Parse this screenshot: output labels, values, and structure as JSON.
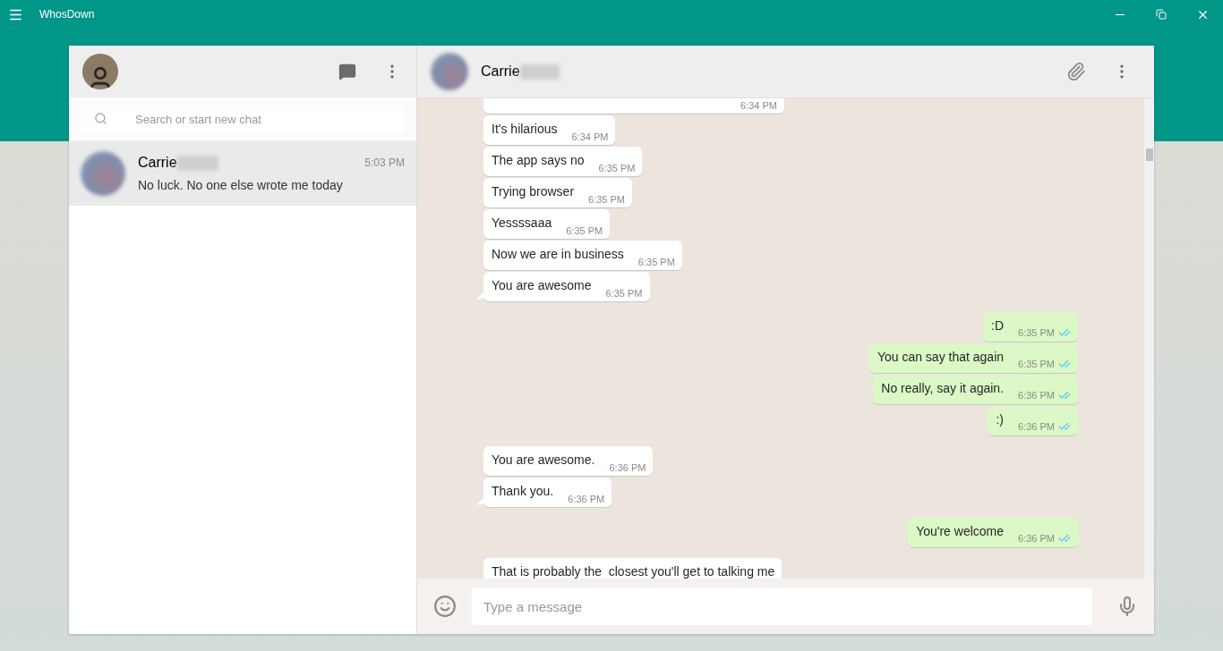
{
  "window": {
    "title": "WhosDown"
  },
  "search": {
    "placeholder": "Search or start new chat"
  },
  "chats": [
    {
      "name": "Carrie",
      "time": "5:03 PM",
      "preview": "No luck. No one else wrote me today",
      "selected": true
    }
  ],
  "conversation": {
    "name": "Carrie"
  },
  "message_groups": [
    {
      "kind": "incoming",
      "messages": [
        {
          "time": "6:34 PM"
        },
        {
          "text": "It's hilarious",
          "time": "6:34 PM"
        },
        {
          "text": "The app says no",
          "time": "6:35 PM"
        },
        {
          "text": "Trying browser",
          "time": "6:35 PM"
        },
        {
          "text": "Yessssaaa",
          "time": "6:35 PM"
        },
        {
          "text": "Now we are in business",
          "time": "6:35 PM"
        },
        {
          "text": "You are awesome",
          "time": "6:35 PM"
        }
      ]
    },
    {
      "kind": "outgoing",
      "messages": [
        {
          "text": ":D",
          "time": "6:35 PM",
          "read": true
        },
        {
          "text": "You can say that again",
          "time": "6:35 PM",
          "read": true
        },
        {
          "text": "No really, say it again.",
          "time": "6:36 PM",
          "read": true
        },
        {
          "text": ":)",
          "time": "6:36 PM",
          "read": true
        }
      ]
    },
    {
      "kind": "incoming",
      "messages": [
        {
          "text": "You are awesome.",
          "time": "6:36 PM"
        },
        {
          "text": "Thank you.",
          "time": "6:36 PM"
        }
      ]
    },
    {
      "kind": "outgoing",
      "messages": [
        {
          "text": "You're welcome",
          "time": "6:36 PM",
          "read": true
        }
      ]
    },
    {
      "kind": "incoming",
      "messages": [
        {
          "text": "That is probably the  closest you'll get to talking me"
        }
      ]
    }
  ],
  "composer": {
    "placeholder": "Type a message"
  }
}
